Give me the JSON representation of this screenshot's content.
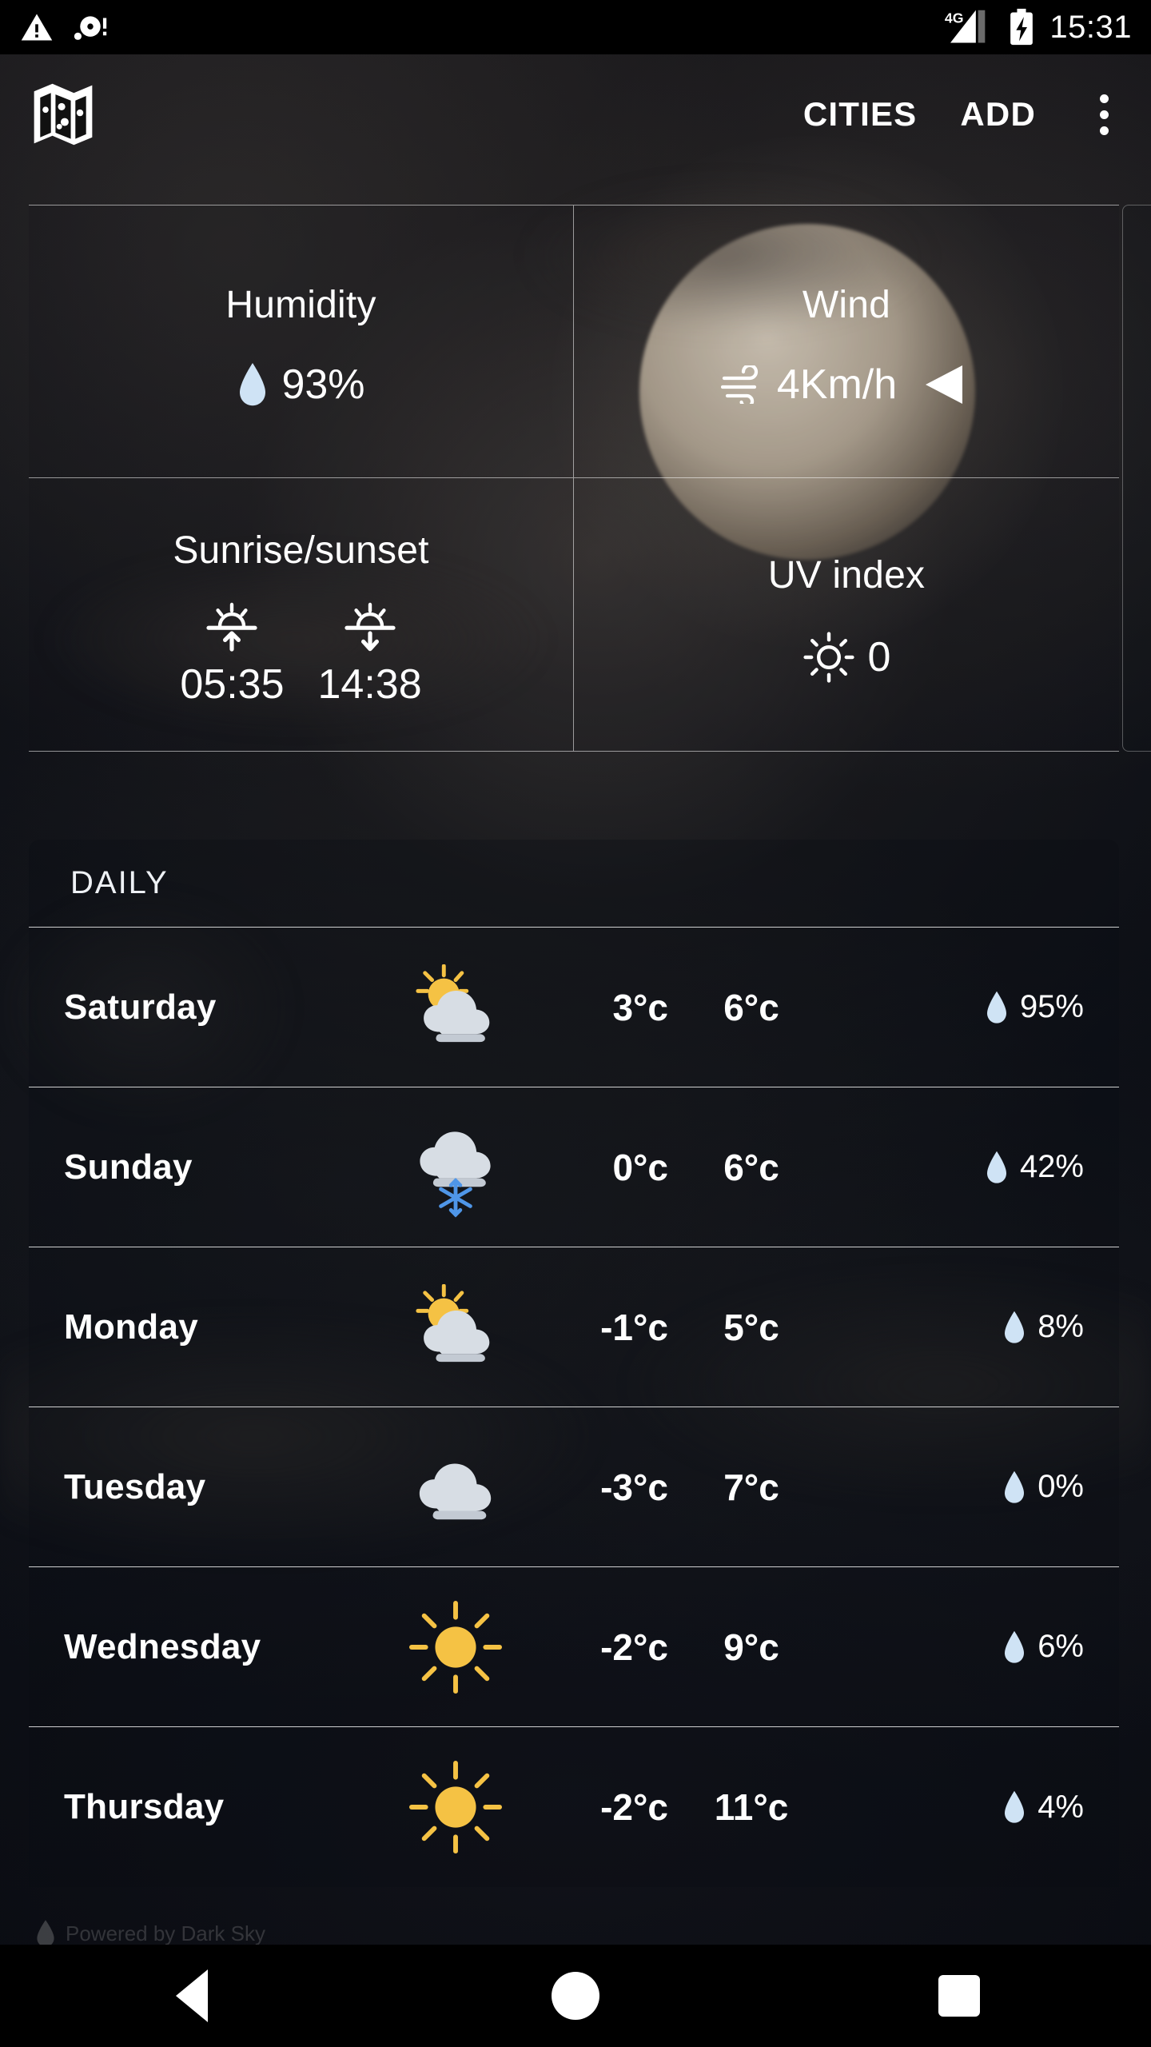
{
  "status_bar": {
    "time": "15:31",
    "network_label": "4G",
    "icons": [
      "warning-triangle-icon",
      "data-saver-icon",
      "signal-icon",
      "battery-charging-icon"
    ]
  },
  "app_bar": {
    "map_icon": "map-icon",
    "cities_label": "CITIES",
    "add_label": "ADD",
    "overflow_icon": "kebab-menu-icon"
  },
  "details": {
    "humidity": {
      "label": "Humidity",
      "value": "93%",
      "icon": "water-drop-icon"
    },
    "wind": {
      "label": "Wind",
      "value": "4Km/h",
      "icon": "wind-icon",
      "direction_icon": "wind-direction-arrow-icon"
    },
    "sun": {
      "label": "Sunrise/sunset",
      "sunrise": "05:35",
      "sunset": "14:38",
      "sunrise_icon": "sunrise-icon",
      "sunset_icon": "sunset-icon"
    },
    "uv": {
      "label": "UV index",
      "value": "0",
      "icon": "sun-small-icon"
    }
  },
  "daily": {
    "header": "DAILY",
    "rows": [
      {
        "day": "Saturday",
        "icon": "partly-cloudy-icon",
        "min": "3°c",
        "max": "6°c",
        "precip": "95%"
      },
      {
        "day": "Sunday",
        "icon": "snow-cloud-icon",
        "min": "0°c",
        "max": "6°c",
        "precip": "42%"
      },
      {
        "day": "Monday",
        "icon": "partly-cloudy-icon",
        "min": "-1°c",
        "max": "5°c",
        "precip": "8%"
      },
      {
        "day": "Tuesday",
        "icon": "cloudy-icon",
        "min": "-3°c",
        "max": "7°c",
        "precip": "0%"
      },
      {
        "day": "Wednesday",
        "icon": "sunny-icon",
        "min": "-2°c",
        "max": "9°c",
        "precip": "6%"
      },
      {
        "day": "Thursday",
        "icon": "sunny-icon",
        "min": "-2°c",
        "max": "11°c",
        "precip": "4%"
      }
    ]
  },
  "footer": {
    "credit": "Powered by Dark Sky",
    "icon": "dark-sky-icon"
  },
  "nav_bar": {
    "back": "back-button",
    "home": "home-button",
    "recents": "recents-button"
  },
  "colors": {
    "accent_drop": "#cfe3f5",
    "sun_yellow": "#f5c244",
    "cloud_gray": "#d7dde4",
    "snow_blue": "#4f96e8",
    "text": "#ffffff"
  }
}
